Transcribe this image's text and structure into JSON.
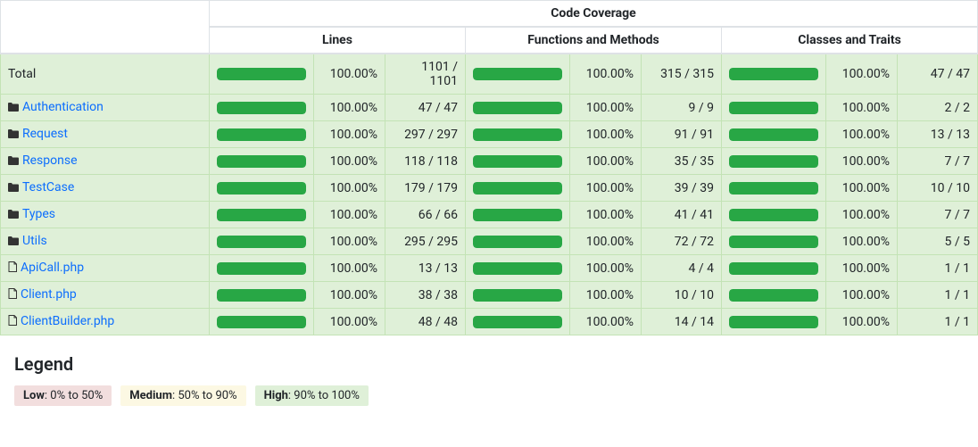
{
  "header": {
    "main": "Code Coverage",
    "col1": "Lines",
    "col2": "Functions and Methods",
    "col3": "Classes and Traits"
  },
  "rows": [
    {
      "name": "Total",
      "type": "total",
      "lines_pct": "100.00%",
      "lines_ratio": "1101 / 1101",
      "funcs_pct": "100.00%",
      "funcs_ratio": "315 / 315",
      "classes_pct": "100.00%",
      "classes_ratio": "47 / 47"
    },
    {
      "name": "Authentication",
      "type": "folder",
      "lines_pct": "100.00%",
      "lines_ratio": "47 / 47",
      "funcs_pct": "100.00%",
      "funcs_ratio": "9 / 9",
      "classes_pct": "100.00%",
      "classes_ratio": "2 / 2"
    },
    {
      "name": "Request",
      "type": "folder",
      "lines_pct": "100.00%",
      "lines_ratio": "297 / 297",
      "funcs_pct": "100.00%",
      "funcs_ratio": "91 / 91",
      "classes_pct": "100.00%",
      "classes_ratio": "13 / 13"
    },
    {
      "name": "Response",
      "type": "folder",
      "lines_pct": "100.00%",
      "lines_ratio": "118 / 118",
      "funcs_pct": "100.00%",
      "funcs_ratio": "35 / 35",
      "classes_pct": "100.00%",
      "classes_ratio": "7 / 7"
    },
    {
      "name": "TestCase",
      "type": "folder",
      "lines_pct": "100.00%",
      "lines_ratio": "179 / 179",
      "funcs_pct": "100.00%",
      "funcs_ratio": "39 / 39",
      "classes_pct": "100.00%",
      "classes_ratio": "10 / 10"
    },
    {
      "name": "Types",
      "type": "folder",
      "lines_pct": "100.00%",
      "lines_ratio": "66 / 66",
      "funcs_pct": "100.00%",
      "funcs_ratio": "41 / 41",
      "classes_pct": "100.00%",
      "classes_ratio": "7 / 7"
    },
    {
      "name": "Utils",
      "type": "folder",
      "lines_pct": "100.00%",
      "lines_ratio": "295 / 295",
      "funcs_pct": "100.00%",
      "funcs_ratio": "72 / 72",
      "classes_pct": "100.00%",
      "classes_ratio": "5 / 5"
    },
    {
      "name": "ApiCall.php",
      "type": "file",
      "lines_pct": "100.00%",
      "lines_ratio": "13 / 13",
      "funcs_pct": "100.00%",
      "funcs_ratio": "4 / 4",
      "classes_pct": "100.00%",
      "classes_ratio": "1 / 1"
    },
    {
      "name": "Client.php",
      "type": "file",
      "lines_pct": "100.00%",
      "lines_ratio": "38 / 38",
      "funcs_pct": "100.00%",
      "funcs_ratio": "10 / 10",
      "classes_pct": "100.00%",
      "classes_ratio": "1 / 1"
    },
    {
      "name": "ClientBuilder.php",
      "type": "file",
      "lines_pct": "100.00%",
      "lines_ratio": "48 / 48",
      "funcs_pct": "100.00%",
      "funcs_ratio": "14 / 14",
      "classes_pct": "100.00%",
      "classes_ratio": "1 / 1"
    }
  ],
  "legend": {
    "title": "Legend",
    "low_label": "Low",
    "low_range": ": 0% to 50%",
    "medium_label": "Medium",
    "medium_range": ": 50% to 90%",
    "high_label": "High",
    "high_range": ": 90% to 100%"
  }
}
